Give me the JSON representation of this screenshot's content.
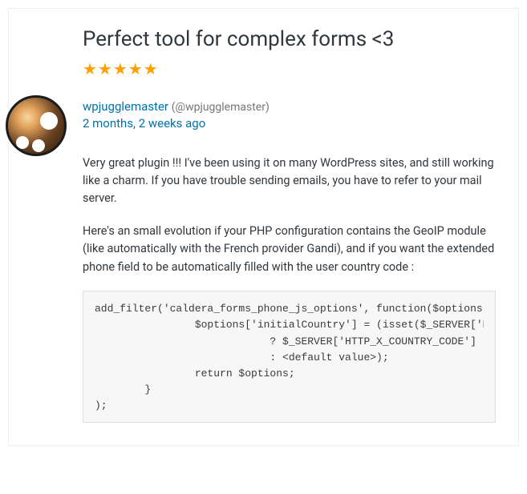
{
  "review": {
    "title": "Perfect tool for complex forms <3",
    "rating_stars": "★★★★★",
    "author_name": "wpjugglemaster",
    "author_handle": "(@wpjugglemaster)",
    "time_ago": "2 months, 2 weeks ago",
    "paragraph1": "Very great plugin !!! I've been using it on many WordPress sites, and still working like a charm. If you have trouble sending emails, you have to refer to your mail server.",
    "paragraph2": "Here's an small evolution if your PHP configuration contains the GeoIP module (like automatically with the French provider Gandi), and if you want the extended phone field to be automatically filled with the user country code :",
    "code": "add_filter('caldera_forms_phone_js_options', function($options)\n                $options['initialCountry'] = (isset($_SERVER['HTTP_X_COUNTRY_CODE'])\n                            ? $_SERVER['HTTP_X_COUNTRY_CODE']\n                            : <default value>);\n                return $options;\n        }\n);"
  }
}
